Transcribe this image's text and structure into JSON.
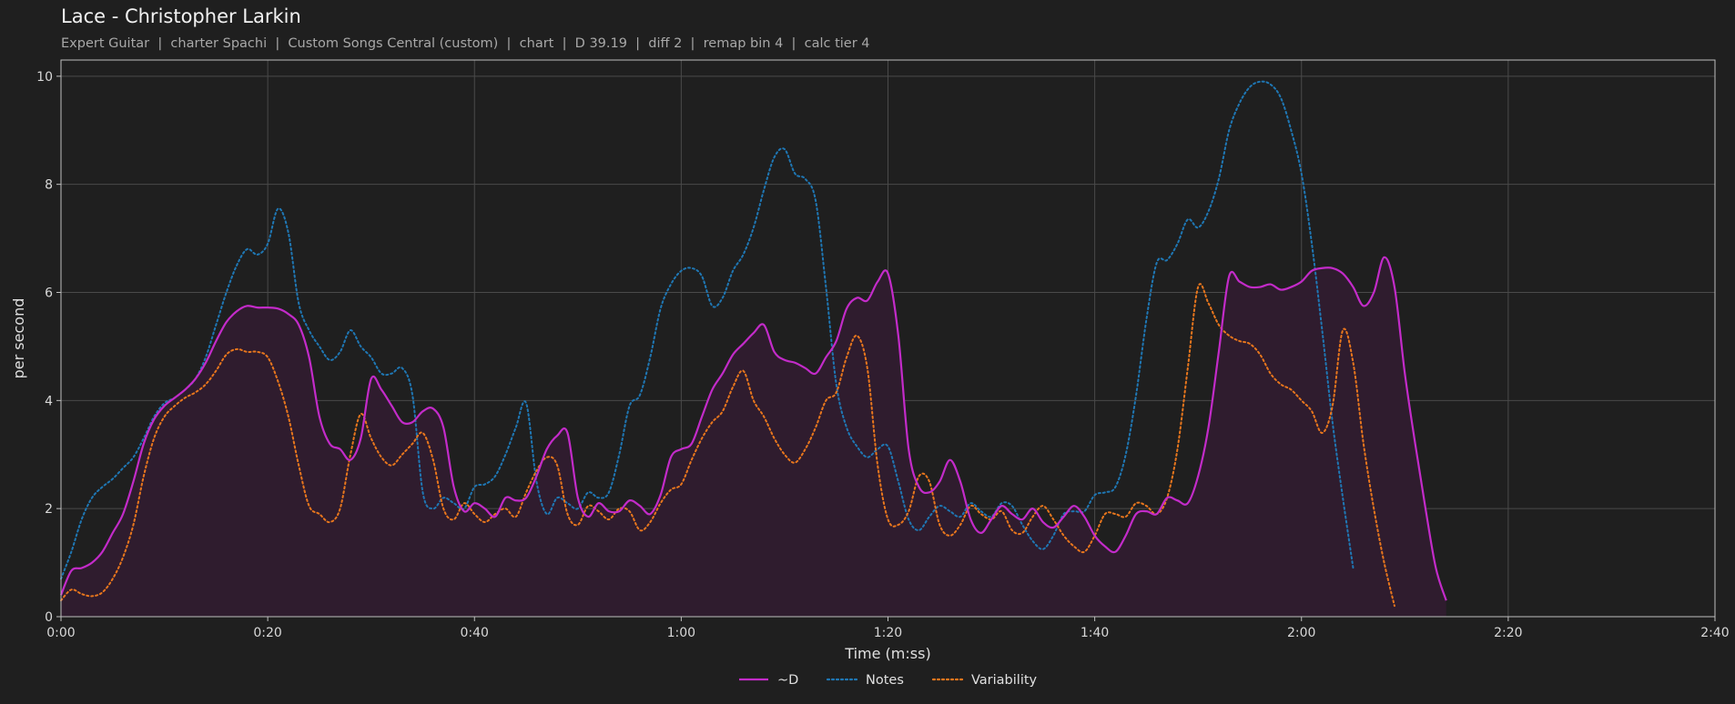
{
  "title": "Lace - Christopher Larkin",
  "subtitle": "Expert Guitar  |  charter Spachi  |  Custom Songs Central (custom)  |  chart  |  D 39.19  |  diff 2  |  remap bin 4  |  calc tier 4",
  "colors": {
    "background": "#1f1f1f",
    "plot_background": "#1f1f1f",
    "grid": "#4a4a4a",
    "d_line": "#c32bc9",
    "d_fill": "#2f1c2e",
    "notes_line": "#1f77b4",
    "variability_line": "#e8761d"
  },
  "chart_data": {
    "type": "line",
    "title": "",
    "xlabel": "Time (m:ss)",
    "ylabel": "per second",
    "xlim": [
      0,
      160
    ],
    "ylim": [
      0,
      10.3
    ],
    "x_ticks": [
      0,
      20,
      40,
      60,
      80,
      100,
      120,
      140,
      160
    ],
    "x_tick_labels": [
      "0:00",
      "0:20",
      "0:40",
      "1:00",
      "1:20",
      "1:40",
      "2:00",
      "2:20",
      "2:40"
    ],
    "y_ticks": [
      0,
      2,
      4,
      6,
      8,
      10
    ],
    "y_tick_labels": [
      "0",
      "2",
      "4",
      "6",
      "8",
      "10"
    ],
    "grid": true,
    "legend_position": "bottom-center",
    "x": [
      0,
      1,
      2,
      3,
      4,
      5,
      6,
      7,
      8,
      9,
      10,
      11,
      12,
      13,
      14,
      15,
      16,
      17,
      18,
      19,
      20,
      21,
      22,
      23,
      24,
      25,
      26,
      27,
      28,
      29,
      30,
      31,
      32,
      33,
      34,
      35,
      36,
      37,
      38,
      39,
      40,
      41,
      42,
      43,
      44,
      45,
      46,
      47,
      48,
      49,
      50,
      51,
      52,
      53,
      54,
      55,
      56,
      57,
      58,
      59,
      60,
      61,
      62,
      63,
      64,
      65,
      66,
      67,
      68,
      69,
      70,
      71,
      72,
      73,
      74,
      75,
      76,
      77,
      78,
      79,
      80,
      81,
      82,
      83,
      84,
      85,
      86,
      87,
      88,
      89,
      90,
      91,
      92,
      93,
      94,
      95,
      96,
      97,
      98,
      99,
      100,
      101,
      102,
      103,
      104,
      105,
      106,
      107,
      108,
      109,
      110,
      111,
      112,
      113,
      114,
      115,
      116,
      117,
      118,
      119,
      120,
      121,
      122,
      123,
      124,
      125,
      126,
      127,
      128,
      129,
      130,
      131,
      132,
      133,
      134,
      135,
      136,
      137,
      138,
      139,
      140,
      141,
      142,
      143,
      144,
      145,
      146,
      147,
      148,
      149,
      150,
      151,
      152,
      153,
      154,
      155,
      156,
      157,
      158,
      159,
      160
    ],
    "series": [
      {
        "name": "~D",
        "style": "solid",
        "fill": true,
        "values": [
          0.4,
          0.85,
          0.9,
          1.0,
          1.2,
          1.55,
          1.9,
          2.5,
          3.2,
          3.65,
          3.9,
          4.05,
          4.2,
          4.4,
          4.7,
          5.1,
          5.45,
          5.65,
          5.75,
          5.72,
          5.72,
          5.7,
          5.6,
          5.4,
          4.8,
          3.7,
          3.2,
          3.1,
          2.9,
          3.3,
          4.4,
          4.2,
          3.9,
          3.6,
          3.6,
          3.8,
          3.85,
          3.5,
          2.4,
          1.95,
          2.1,
          2.0,
          1.85,
          2.2,
          2.15,
          2.2,
          2.6,
          3.1,
          3.35,
          3.4,
          2.2,
          1.85,
          2.1,
          1.95,
          1.95,
          2.15,
          2.05,
          1.9,
          2.25,
          2.95,
          3.1,
          3.2,
          3.7,
          4.2,
          4.5,
          4.85,
          5.05,
          5.25,
          5.4,
          4.9,
          4.75,
          4.7,
          4.6,
          4.5,
          4.8,
          5.1,
          5.7,
          5.9,
          5.85,
          6.2,
          6.35,
          5.2,
          3.1,
          2.4,
          2.3,
          2.5,
          2.9,
          2.5,
          1.8,
          1.55,
          1.8,
          2.05,
          1.9,
          1.8,
          2.0,
          1.75,
          1.65,
          1.85,
          2.05,
          1.85,
          1.5,
          1.3,
          1.2,
          1.5,
          1.9,
          1.95,
          1.9,
          2.2,
          2.15,
          2.1,
          2.6,
          3.5,
          4.9,
          6.3,
          6.2,
          6.1,
          6.1,
          6.15,
          6.05,
          6.1,
          6.2,
          6.4,
          6.45,
          6.45,
          6.35,
          6.1,
          5.75,
          6.0,
          6.65,
          6.1,
          4.5,
          3.2,
          2.0,
          0.9,
          0.3
        ]
      },
      {
        "name": "Notes",
        "style": "dotted",
        "fill": false,
        "values": [
          0.7,
          1.2,
          1.8,
          2.2,
          2.4,
          2.55,
          2.75,
          2.95,
          3.3,
          3.7,
          3.95,
          4.05,
          4.2,
          4.4,
          4.8,
          5.4,
          6.0,
          6.5,
          6.8,
          6.7,
          6.9,
          7.55,
          7.1,
          5.8,
          5.3,
          5.0,
          4.75,
          4.9,
          5.3,
          5.0,
          4.8,
          4.5,
          4.5,
          4.6,
          4.1,
          2.3,
          2.0,
          2.2,
          2.1,
          2.0,
          2.4,
          2.45,
          2.6,
          3.0,
          3.5,
          3.95,
          2.5,
          1.9,
          2.2,
          2.1,
          2.0,
          2.3,
          2.2,
          2.3,
          3.0,
          3.9,
          4.1,
          4.8,
          5.7,
          6.15,
          6.4,
          6.45,
          6.3,
          5.75,
          5.9,
          6.4,
          6.7,
          7.2,
          7.9,
          8.5,
          8.65,
          8.2,
          8.1,
          7.7,
          6.1,
          4.3,
          3.5,
          3.15,
          2.95,
          3.1,
          3.15,
          2.5,
          1.8,
          1.6,
          1.85,
          2.05,
          1.95,
          1.85,
          2.1,
          1.95,
          1.85,
          2.1,
          2.05,
          1.7,
          1.4,
          1.25,
          1.5,
          1.9,
          1.95,
          1.95,
          2.25,
          2.3,
          2.4,
          3.0,
          4.1,
          5.5,
          6.55,
          6.6,
          6.9,
          7.35,
          7.2,
          7.5,
          8.1,
          9.0,
          9.5,
          9.8,
          9.9,
          9.85,
          9.6,
          9.0,
          8.2,
          6.9,
          5.3,
          3.6,
          2.2,
          0.9
        ]
      },
      {
        "name": "Variability",
        "style": "dotted",
        "fill": false,
        "values": [
          0.3,
          0.5,
          0.42,
          0.38,
          0.45,
          0.7,
          1.1,
          1.7,
          2.6,
          3.3,
          3.7,
          3.9,
          4.05,
          4.15,
          4.3,
          4.55,
          4.85,
          4.95,
          4.9,
          4.9,
          4.8,
          4.35,
          3.7,
          2.8,
          2.05,
          1.9,
          1.75,
          2.0,
          3.0,
          3.75,
          3.3,
          2.95,
          2.8,
          3.0,
          3.2,
          3.4,
          2.9,
          2.0,
          1.8,
          2.1,
          1.9,
          1.75,
          1.9,
          2.0,
          1.85,
          2.3,
          2.7,
          2.95,
          2.8,
          1.9,
          1.7,
          2.05,
          1.95,
          1.8,
          2.0,
          1.95,
          1.6,
          1.75,
          2.1,
          2.35,
          2.45,
          2.9,
          3.3,
          3.6,
          3.8,
          4.25,
          4.55,
          4.0,
          3.7,
          3.3,
          3.0,
          2.85,
          3.1,
          3.5,
          4.0,
          4.15,
          4.8,
          5.2,
          4.6,
          2.8,
          1.8,
          1.7,
          1.95,
          2.6,
          2.5,
          1.7,
          1.5,
          1.7,
          2.05,
          1.9,
          1.8,
          1.95,
          1.6,
          1.55,
          1.85,
          2.05,
          1.8,
          1.5,
          1.3,
          1.2,
          1.5,
          1.9,
          1.9,
          1.85,
          2.1,
          2.05,
          1.9,
          2.2,
          3.1,
          4.6,
          6.1,
          5.8,
          5.4,
          5.2,
          5.1,
          5.05,
          4.85,
          4.5,
          4.3,
          4.2,
          4.0,
          3.8,
          3.4,
          3.9,
          5.3,
          4.7,
          3.2,
          2.0,
          1.0,
          0.2
        ]
      }
    ]
  }
}
